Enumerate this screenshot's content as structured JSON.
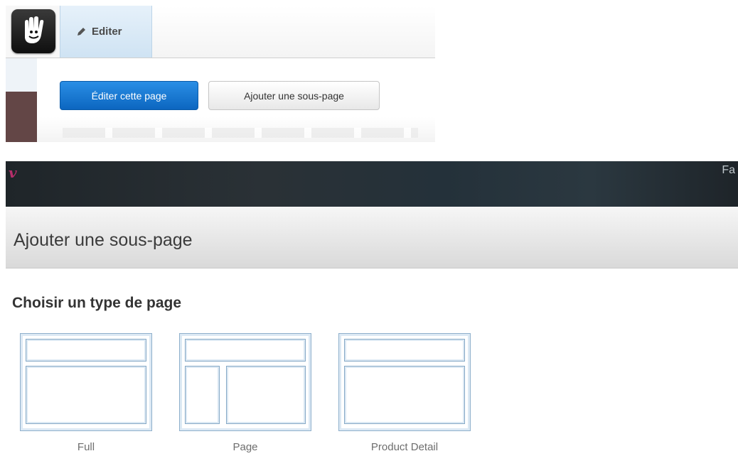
{
  "toolbar": {
    "edit_tab_label": "Editer",
    "edit_page_button": "Éditer cette page",
    "add_subpage_button": "Ajouter une sous-page"
  },
  "site_header": {
    "brand_glyph": "v",
    "right_text": "Fa"
  },
  "dialog": {
    "title": "Ajouter une sous-page",
    "section_title": "Choisir un type de page",
    "page_types": [
      {
        "label": "Full",
        "layout": "full"
      },
      {
        "label": "Page",
        "layout": "sidebar-left"
      },
      {
        "label": "Product Detail",
        "layout": "full"
      }
    ]
  },
  "colors": {
    "primary_button": "#0c66c0",
    "brand_accent": "#b52e6a",
    "template_border": "#8fb0cc"
  }
}
